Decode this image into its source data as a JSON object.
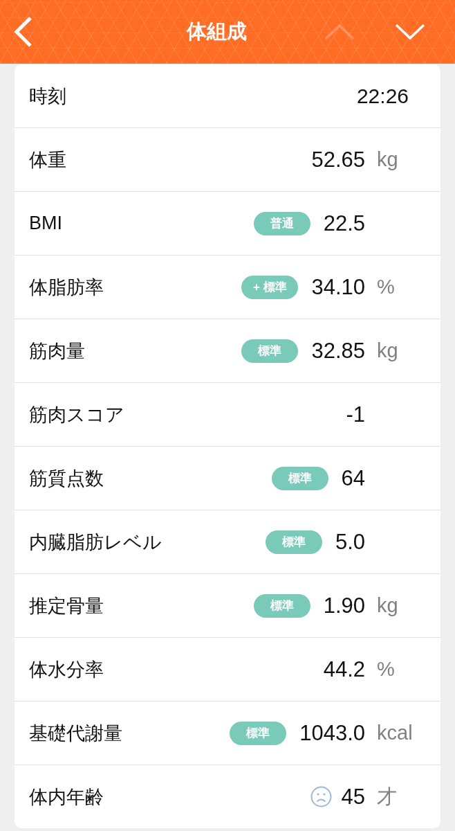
{
  "header": {
    "title": "体組成",
    "nav_buttons": [
      {
        "kind": "up",
        "disabled": true
      },
      {
        "kind": "down",
        "disabled": false
      }
    ]
  },
  "rows": [
    {
      "kind": "time",
      "label": "時刻",
      "value": "22:26"
    },
    {
      "kind": "measure",
      "label": "体重",
      "value": "52.65",
      "unit": "kg"
    },
    {
      "kind": "measure",
      "label": "BMI",
      "badge": "普通",
      "value": "22.5"
    },
    {
      "kind": "measure",
      "label": "体脂肪率",
      "badge": "+ 標準",
      "value": "34.10",
      "unit": "%"
    },
    {
      "kind": "measure",
      "label": "筋肉量",
      "badge": "標準",
      "value": "32.85",
      "unit": "kg"
    },
    {
      "kind": "measure",
      "label": "筋肉スコア",
      "value": "-1"
    },
    {
      "kind": "measure",
      "label": "筋質点数",
      "badge": "標準",
      "value": "64"
    },
    {
      "kind": "measure",
      "label": "内臓脂肪レベル",
      "badge": "標準",
      "value": "5.0"
    },
    {
      "kind": "measure",
      "label": "推定骨量",
      "badge": "標準",
      "value": "1.90",
      "unit": "kg"
    },
    {
      "kind": "measure",
      "label": "体水分率",
      "value": "44.2",
      "unit": "%"
    },
    {
      "kind": "measure",
      "label": "基礎代謝量",
      "badge": "標準",
      "value": "1043.0",
      "unit": "kcal"
    },
    {
      "kind": "rated",
      "label": "体内年齢",
      "good": false,
      "value": "45",
      "unit": "才"
    }
  ]
}
